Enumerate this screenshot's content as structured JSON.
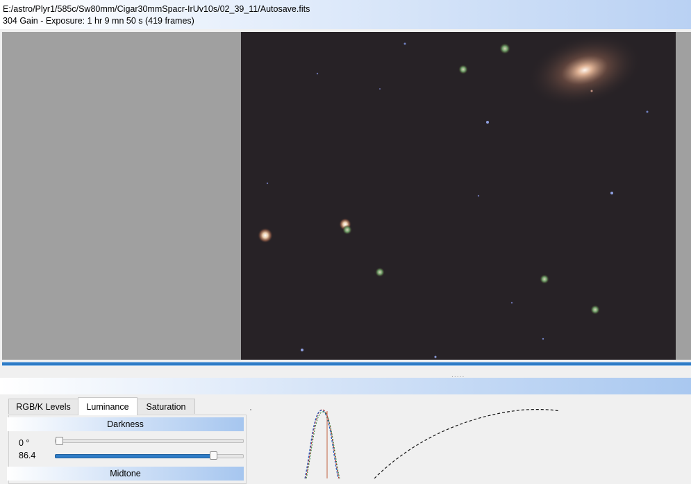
{
  "header": {
    "file_path": "E:/astro/Plyr1/585c/Sw80mm/Cigar30mmSpacr-IrUv10s/02_39_11/Autosave.fits",
    "info": "304 Gain - Exposure: 1 hr 9 mn 50 s (419 frames)"
  },
  "splitter": {
    "grip": "....."
  },
  "tabs": [
    {
      "label": "RGB/K Levels"
    },
    {
      "label": "Luminance"
    },
    {
      "label": "Saturation"
    }
  ],
  "active_tab": "Luminance",
  "luminance": {
    "darkness": {
      "title": "Darkness",
      "angle_value": "0 °",
      "angle_level": 0.0,
      "level_value": "86.4",
      "level_fraction": 0.85
    },
    "midtone": {
      "title": "Midtone"
    }
  },
  "colors": {
    "accent": "#2f7cc6",
    "sky": "#272226",
    "viewer_bg": "#a0a0a0"
  }
}
